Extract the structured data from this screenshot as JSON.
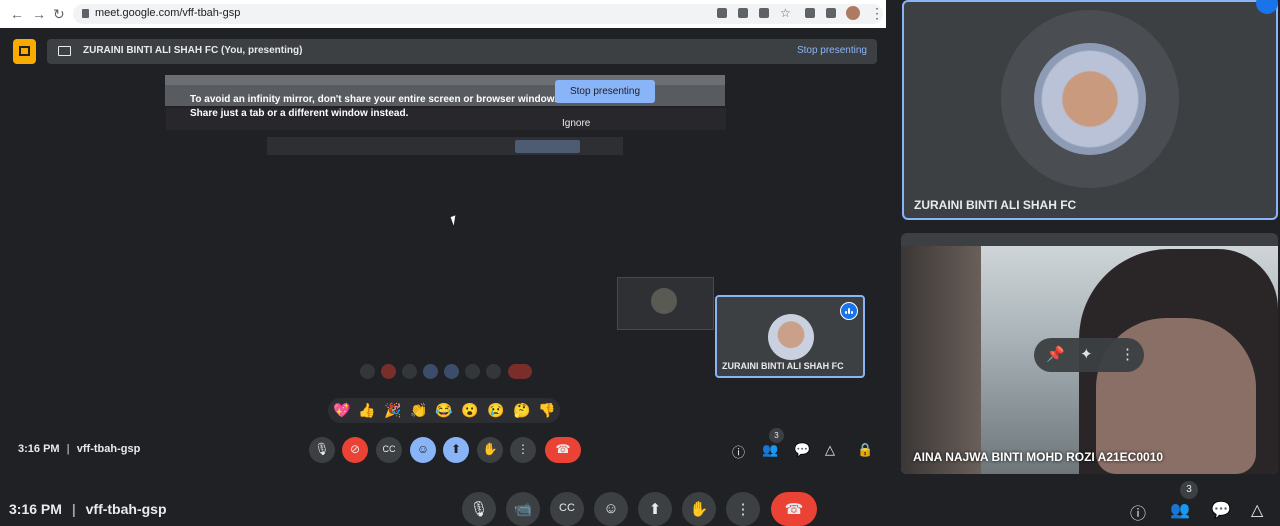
{
  "browser": {
    "url": "meet.google.com/vff-tbah-gsp"
  },
  "presenting_bar": {
    "name": "ZURAINI BINTI ALI SHAH FC (You, presenting)",
    "stop_label": "Stop presenting"
  },
  "infinity_warning": {
    "line1": "To avoid an infinity mirror, don't share your entire screen or browser window.",
    "line2": "Share just a tab or a different window instead.",
    "stop_label": "Stop presenting",
    "ignore_label": "Ignore"
  },
  "self_tile": {
    "name": "ZURAINI BINTI ALI SHAH FC"
  },
  "reactions": [
    "💖",
    "👍",
    "🎉",
    "👏",
    "😂",
    "😮",
    "😢",
    "🤔",
    "👎"
  ],
  "inner_bar": {
    "time": "3:16 PM",
    "separator": "|",
    "code": "vff-tbah-gsp",
    "people_count": "3"
  },
  "tiles": {
    "main": {
      "name": "ZURAINI BINTI ALI SHAH FC"
    },
    "camera": {
      "name": "AINA NAJWA BINTI MOHD ROZI A21EC0010"
    }
  },
  "bottom_bar": {
    "time": "3:16 PM",
    "separator": "|",
    "code": "vff-tbah-gsp",
    "people_count": "3"
  },
  "colors": {
    "accent": "#8ab4f8",
    "end_call": "#ea4335",
    "presenter_badge": "#f9ab00"
  }
}
